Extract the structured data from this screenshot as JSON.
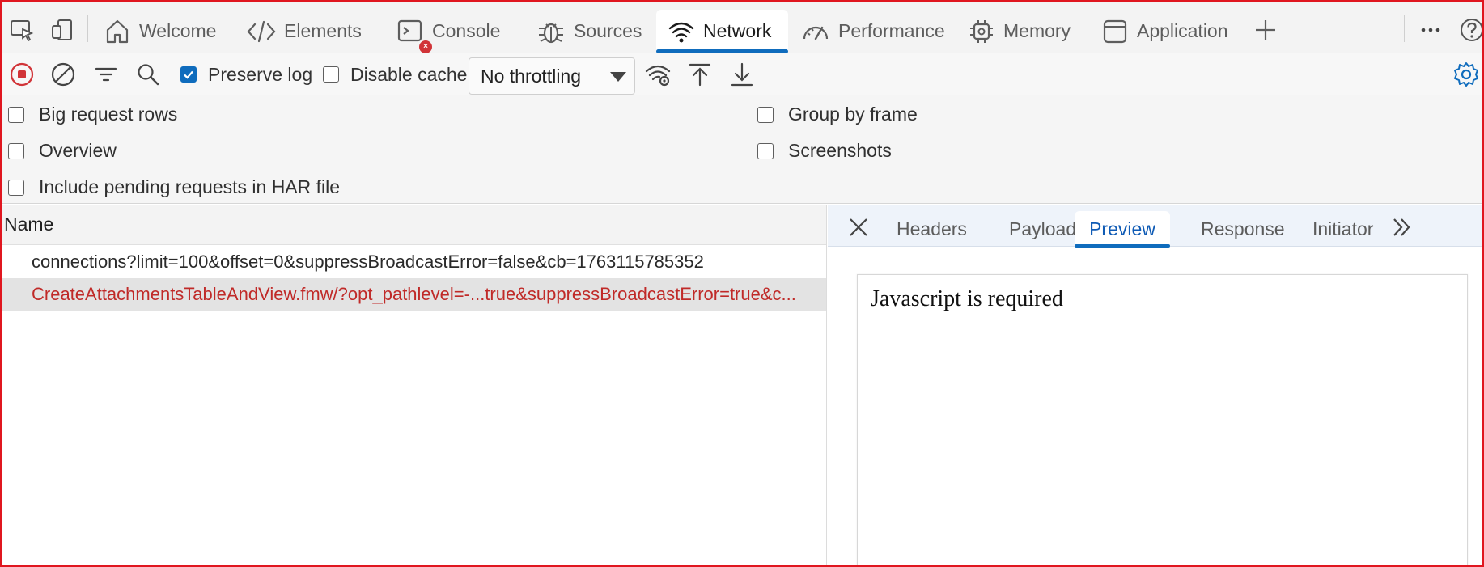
{
  "tabs": {
    "welcome": "Welcome",
    "elements": "Elements",
    "console": "Console",
    "sources": "Sources",
    "network": "Network",
    "performance": "Performance",
    "memory": "Memory",
    "application": "Application",
    "console_badge": "×"
  },
  "toolbar": {
    "preserve_log": "Preserve log",
    "preserve_log_checked": true,
    "disable_cache": "Disable cache",
    "disable_cache_checked": false,
    "throttling": "No throttling"
  },
  "settings": {
    "big_request_rows": "Big request rows",
    "group_by_frame": "Group by frame",
    "overview": "Overview",
    "screenshots": "Screenshots",
    "include_pending": "Include pending requests in HAR file"
  },
  "requests": {
    "header": "Name",
    "rows": [
      {
        "name": "connections?limit=100&offset=0&suppressBroadcastError=false&cb=1763115785352",
        "status": "ok"
      },
      {
        "name": "CreateAttachmentsTableAndView.fmw/?opt_pathlevel=-...true&suppressBroadcastError=true&c...",
        "status": "error",
        "selected": true
      }
    ]
  },
  "detail": {
    "tabs": [
      "Headers",
      "Payload",
      "Preview",
      "Response",
      "Initiator"
    ],
    "active_tab": "Preview",
    "preview_text": "Javascript is required"
  },
  "colors": {
    "accent": "#0f6cbd",
    "error_text": "#c02a28",
    "record": "#d13438"
  }
}
